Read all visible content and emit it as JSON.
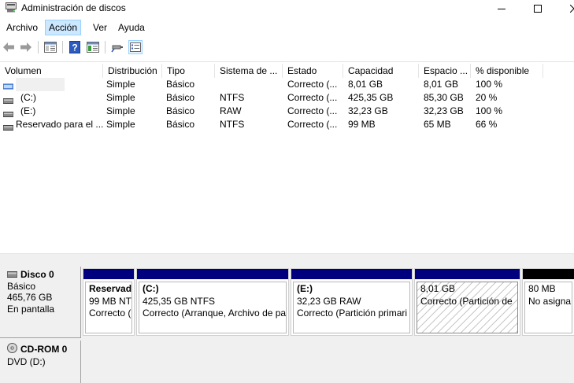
{
  "window": {
    "title": "Administración de discos",
    "icon": "disk-management-icon"
  },
  "menu": [
    "Archivo",
    "Acción",
    "Ver",
    "Ayuda"
  ],
  "toolbar": {
    "icons": [
      "back-arrow-icon",
      "forward-arrow-icon",
      "console-tree-icon",
      "help-icon",
      "properties-icon",
      "connect-icon",
      "view-list-icon"
    ]
  },
  "volumes": {
    "columns": [
      "Volumen",
      "Distribución",
      "Tipo",
      "Sistema de ...",
      "Estado",
      "Capacidad",
      "Espacio ...",
      "% disponible"
    ],
    "rows": [
      {
        "icon": "removable-volume-icon",
        "name": "",
        "layout": "Simple",
        "type": "Básico",
        "fs": "",
        "status": "Correcto (...",
        "capacity": "8,01 GB",
        "free": "8,01 GB",
        "pct": "100 %"
      },
      {
        "icon": "volume-icon",
        "name": "(C:)",
        "layout": "Simple",
        "type": "Básico",
        "fs": "NTFS",
        "status": "Correcto (...",
        "capacity": "425,35 GB",
        "free": "85,30 GB",
        "pct": "20 %"
      },
      {
        "icon": "volume-icon",
        "name": "(E:)",
        "layout": "Simple",
        "type": "Básico",
        "fs": "RAW",
        "status": "Correcto (...",
        "capacity": "32,23 GB",
        "free": "32,23 GB",
        "pct": "100 %"
      },
      {
        "icon": "volume-icon",
        "name": "Reservado para el ...",
        "layout": "Simple",
        "type": "Básico",
        "fs": "NTFS",
        "status": "Correcto (...",
        "capacity": "99 MB",
        "free": "65 MB",
        "pct": "66 %"
      }
    ]
  },
  "disks": [
    {
      "name": "Disco 0",
      "type": "Básico",
      "size": "465,76 GB",
      "status": "En pantalla",
      "partitions": [
        {
          "title": "Reservado",
          "size_fs": "99 MB NT",
          "status": "Correcto (",
          "bar_color": "#00007f"
        },
        {
          "title": "(C:)",
          "size_fs": "425,35 GB NTFS",
          "status": "Correcto (Arranque, Archivo de pa",
          "bar_color": "#00007f"
        },
        {
          "title": "(E:)",
          "size_fs": "32,23 GB RAW",
          "status": "Correcto (Partición primari",
          "bar_color": "#00007f"
        },
        {
          "title": "",
          "size_fs": "8,01 GB",
          "status": "Correcto (Partición de",
          "bar_color": "#00007f"
        },
        {
          "title": "",
          "size_fs": "80 MB",
          "status": "No asigna",
          "bar_color": "#000000"
        }
      ]
    },
    {
      "name": "CD-ROM 0",
      "type": "DVD (D:)"
    }
  ]
}
